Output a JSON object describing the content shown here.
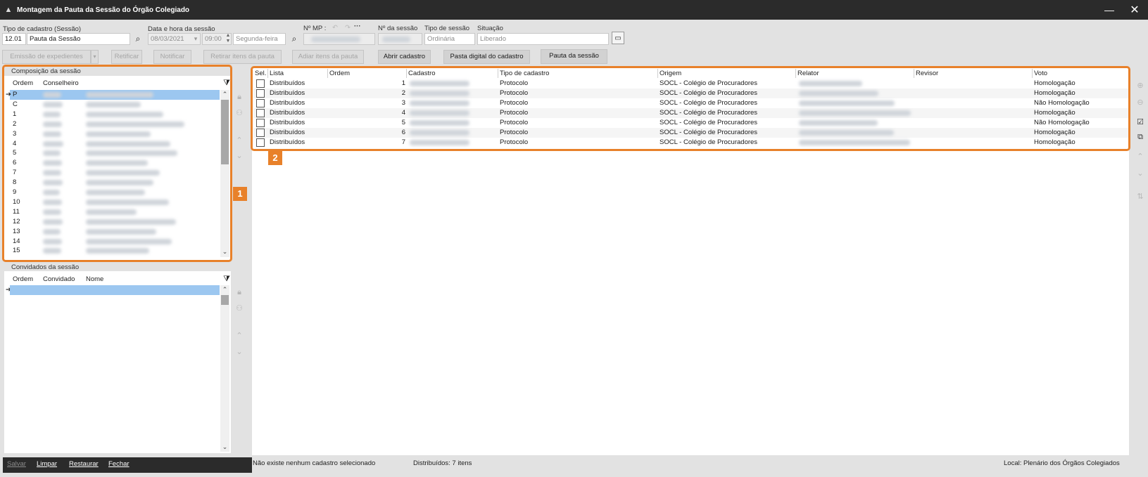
{
  "window": {
    "title": "Montagem da Pauta da Sessão do Órgão Colegiado",
    "minimize_glyph": "—",
    "close_glyph": "✕"
  },
  "form": {
    "tipo_cadastro_label": "Tipo de cadastro (Sessão)",
    "tipo_cadastro_code": "12.01",
    "tipo_cadastro_name": "Pauta da Sessão",
    "data_hora_label": "Data e hora da sessão",
    "data": "08/03/2021",
    "hora": "09:00",
    "dia_semana": "Segunda-feira",
    "nmp_label": "Nº MP :",
    "nsessao_label": "Nº da sessão",
    "tipo_sessao_label": "Tipo de sessão",
    "tipo_sessao": "Ordinária",
    "situacao_label": "Situação",
    "situacao": "Liberado"
  },
  "toolbar": {
    "emissao": "Emissão de expedientes",
    "retificar": "Retificar",
    "notificar": "Notificar",
    "retirar": "Retirar itens da pauta",
    "adiar": "Adiar itens da pauta",
    "abrir": "Abrir cadastro",
    "pasta": "Pasta digital do cadastro",
    "pauta": "Pauta da sessão"
  },
  "composicao": {
    "title": "Composição da sessão",
    "col_ordem": "Ordem",
    "col_conselheiro": "Conselheiro",
    "rows": [
      "P",
      "C",
      "1",
      "2",
      "3",
      "4",
      "5",
      "6",
      "7",
      "8",
      "9",
      "10",
      "11",
      "12",
      "13",
      "14",
      "15"
    ]
  },
  "convidados": {
    "title": "Convidados da sessão",
    "col_ordem": "Ordem",
    "col_convidado": "Convidado",
    "col_nome": "Nome"
  },
  "grid": {
    "headers": [
      "Sel.",
      "Lista",
      "Ordem",
      "Cadastro",
      "Tipo de cadastro",
      "Origem",
      "Relator",
      "Revisor",
      "Voto"
    ],
    "rows": [
      {
        "lista": "Distribuídos",
        "ordem": "1",
        "tipo": "Protocolo",
        "origem": "SOCL - Colégio de Procuradores",
        "voto": "Homologação"
      },
      {
        "lista": "Distribuídos",
        "ordem": "2",
        "tipo": "Protocolo",
        "origem": "SOCL - Colégio de Procuradores",
        "voto": "Homologação"
      },
      {
        "lista": "Distribuídos",
        "ordem": "3",
        "tipo": "Protocolo",
        "origem": "SOCL - Colégio de Procuradores",
        "voto": "Não Homologação"
      },
      {
        "lista": "Distribuídos",
        "ordem": "4",
        "tipo": "Protocolo",
        "origem": "SOCL - Colégio de Procuradores",
        "voto": "Homologação"
      },
      {
        "lista": "Distribuídos",
        "ordem": "5",
        "tipo": "Protocolo",
        "origem": "SOCL - Colégio de Procuradores",
        "voto": "Não Homologação"
      },
      {
        "lista": "Distribuídos",
        "ordem": "6",
        "tipo": "Protocolo",
        "origem": "SOCL - Colégio de Procuradores",
        "voto": "Homologação"
      },
      {
        "lista": "Distribuídos",
        "ordem": "7",
        "tipo": "Protocolo",
        "origem": "SOCL - Colégio de Procuradores",
        "voto": "Homologação"
      }
    ]
  },
  "badges": {
    "one": "1",
    "two": "2"
  },
  "status": {
    "selection": "Não existe nenhum cadastro selecionado",
    "count": "Distribuídos: 7 itens",
    "local": "Local: Plenário dos Órgãos Colegiados"
  },
  "footer": {
    "salvar": "Salvar",
    "limpar": "Limpar",
    "restaurar": "Restaurar",
    "fechar": "Fechar"
  },
  "colors": {
    "accent": "#e8812a",
    "titlebar": "#2b2b2b",
    "selection": "#9cc7f0"
  }
}
